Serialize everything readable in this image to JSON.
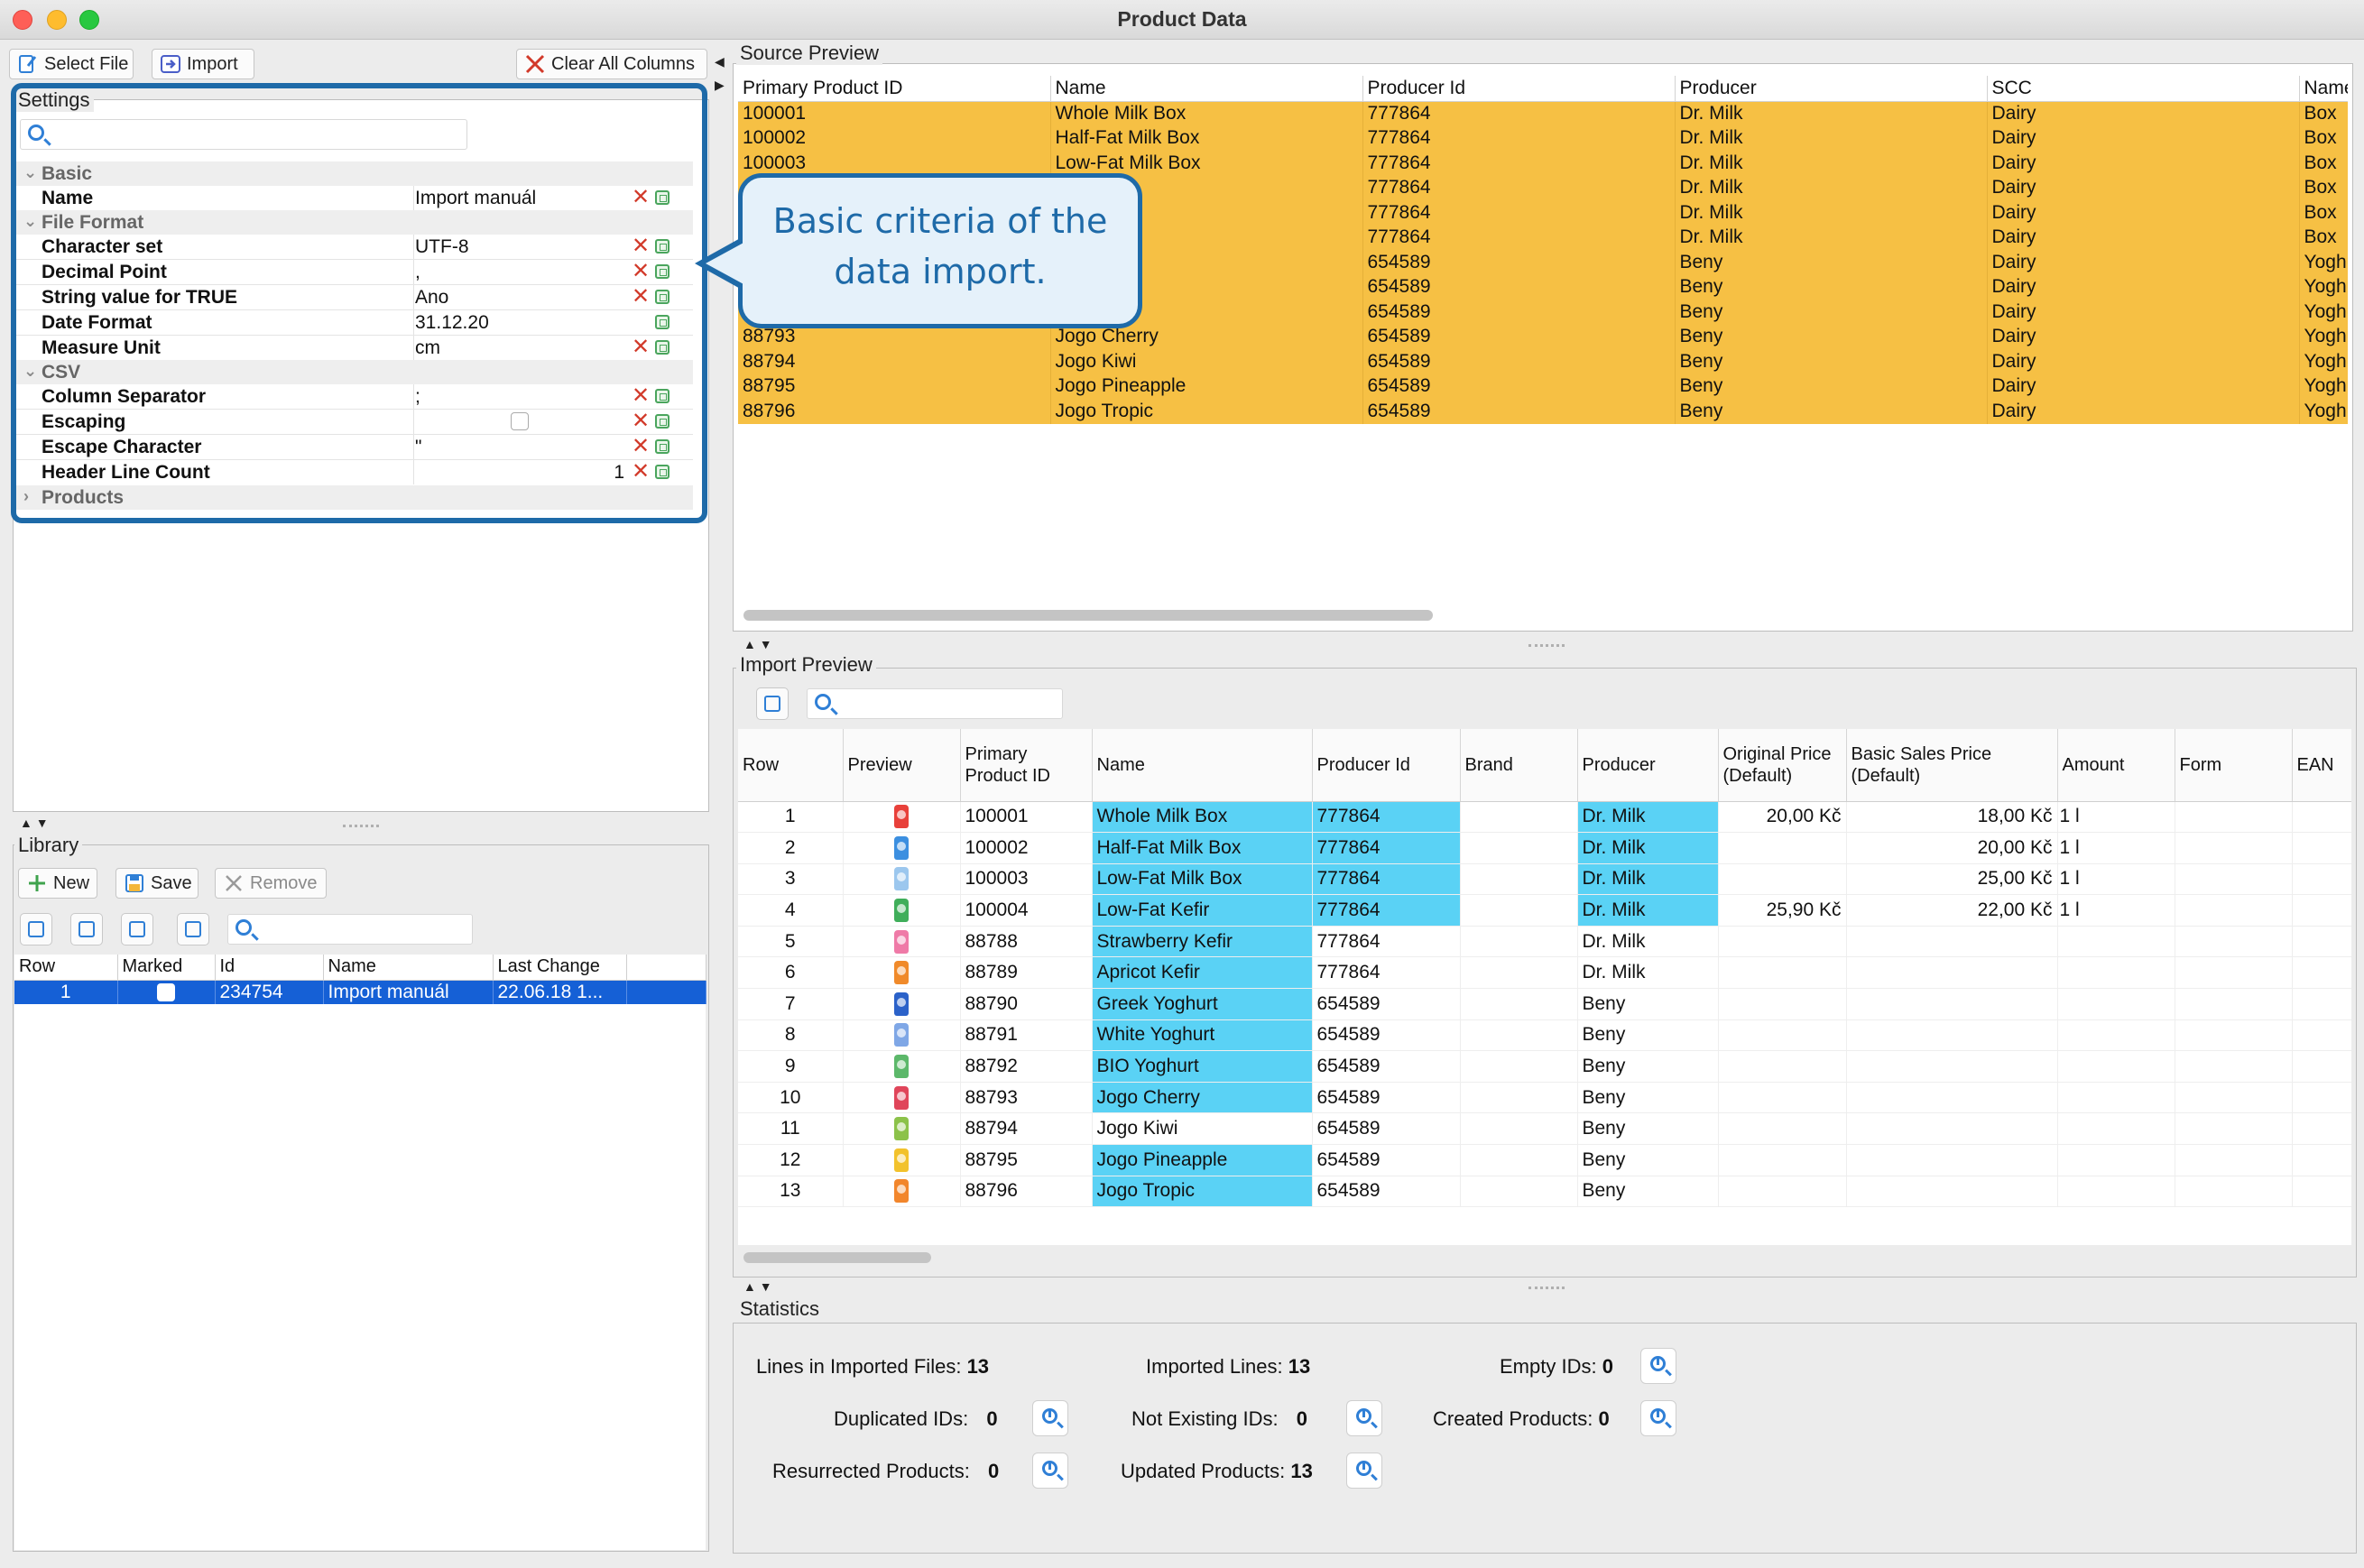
{
  "window": {
    "title": "Product Data",
    "colors": {
      "close": "#fe5f57",
      "minimize": "#febc2e",
      "zoom": "#28c840",
      "highlight_blue": "#5ad2f5",
      "source_orange": "#f6c044",
      "selection": "#1560d6",
      "callout_border": "#1e6aa8"
    }
  },
  "toolbar": {
    "select_file": "Select File",
    "import": "Import",
    "clear_all_columns": "Clear All Columns"
  },
  "settings": {
    "label": "Settings",
    "search_placeholder": "",
    "sections": {
      "basic": "Basic",
      "file_format": "File Format",
      "csv": "CSV",
      "products": "Products"
    },
    "rows": [
      {
        "key": "Name",
        "value": "Import manuál"
      },
      {
        "key": "Character set",
        "value": "UTF-8"
      },
      {
        "key": "Decimal Point",
        "value": ","
      },
      {
        "key": "String value for TRUE",
        "value": "Ano"
      },
      {
        "key": "Date Format",
        "value": "31.12.20"
      },
      {
        "key": "Measure Unit",
        "value": "cm"
      },
      {
        "key": "Column Separator",
        "value": ";"
      },
      {
        "key": "Escaping",
        "value": ""
      },
      {
        "key": "Escape Character",
        "value": "\""
      },
      {
        "key": "Header Line Count",
        "value": "1"
      }
    ]
  },
  "callout": {
    "line1": "Basic criteria of the",
    "line2": "data import."
  },
  "library": {
    "label": "Library",
    "new": "New",
    "save": "Save",
    "remove": "Remove",
    "columns": [
      "Row",
      "Marked",
      "Id",
      "Name",
      "Last Change"
    ],
    "rows": [
      {
        "row": "1",
        "id": "234754",
        "name": "Import manuál",
        "last_change": "22.06.18 1..."
      }
    ]
  },
  "source_preview": {
    "label": "Source Preview",
    "columns": [
      "Primary Product ID",
      "Name",
      "Producer Id",
      "Producer",
      "SCC",
      "Name"
    ],
    "rows": [
      [
        "100001",
        "Whole Milk Box",
        "777864",
        "Dr. Milk",
        "Dairy",
        "Box"
      ],
      [
        "100002",
        "Half-Fat Milk Box",
        "777864",
        "Dr. Milk",
        "Dairy",
        "Box"
      ],
      [
        "100003",
        "Low-Fat Milk Box",
        "777864",
        "Dr. Milk",
        "Dairy",
        "Box"
      ],
      [
        "",
        "Kefir",
        "777864",
        "Dr. Milk",
        "Dairy",
        "Box"
      ],
      [
        "",
        "y Kefir",
        "777864",
        "Dr. Milk",
        "Dairy",
        "Box"
      ],
      [
        "",
        "efir",
        "777864",
        "Dr. Milk",
        "Dairy",
        "Box"
      ],
      [
        "",
        "ghurt",
        "654589",
        "Beny",
        "Dairy",
        "Yoghu"
      ],
      [
        "",
        "hurt",
        "654589",
        "Beny",
        "Dairy",
        "Yoghu"
      ],
      [
        "",
        "urt",
        "654589",
        "Beny",
        "Dairy",
        "Yoghu"
      ],
      [
        "88793",
        "Jogo Cherry",
        "654589",
        "Beny",
        "Dairy",
        "Yoghu"
      ],
      [
        "88794",
        "Jogo Kiwi",
        "654589",
        "Beny",
        "Dairy",
        "Yoghu"
      ],
      [
        "88795",
        "Jogo Pineapple",
        "654589",
        "Beny",
        "Dairy",
        "Yoghu"
      ],
      [
        "88796",
        "Jogo Tropic",
        "654589",
        "Beny",
        "Dairy",
        "Yoghu"
      ]
    ]
  },
  "import_preview": {
    "label": "Import Preview",
    "columns": [
      {
        "l1": "Row",
        "l2": ""
      },
      {
        "l1": "Preview",
        "l2": ""
      },
      {
        "l1": "Primary",
        "l2": "Product ID"
      },
      {
        "l1": "Name",
        "l2": ""
      },
      {
        "l1": "Producer Id",
        "l2": ""
      },
      {
        "l1": "Brand",
        "l2": ""
      },
      {
        "l1": "Producer",
        "l2": ""
      },
      {
        "l1": "Original Price",
        "l2": "(Default)"
      },
      {
        "l1": "Basic Sales Price",
        "l2": "(Default)"
      },
      {
        "l1": "Amount",
        "l2": ""
      },
      {
        "l1": "Form",
        "l2": ""
      },
      {
        "l1": "EAN",
        "l2": ""
      }
    ],
    "rows": [
      {
        "row": "1",
        "color": "#e8403a",
        "id": "100001",
        "name": "Whole Milk Box",
        "producer_id": "777864",
        "producer": "Dr. Milk",
        "orig": "20,00 Kč",
        "sales": "18,00 Kč",
        "amount": "1 l",
        "hl_name": true,
        "hl_pid": true,
        "hl_prod": true
      },
      {
        "row": "2",
        "color": "#3c8fe0",
        "id": "100002",
        "name": "Half-Fat Milk Box",
        "producer_id": "777864",
        "producer": "Dr. Milk",
        "orig": "",
        "sales": "20,00 Kč",
        "amount": "1 l",
        "hl_name": true,
        "hl_pid": true,
        "hl_prod": true
      },
      {
        "row": "3",
        "color": "#9cc7ee",
        "id": "100003",
        "name": "Low-Fat Milk Box",
        "producer_id": "777864",
        "producer": "Dr. Milk",
        "orig": "",
        "sales": "25,00 Kč",
        "amount": "1 l",
        "hl_name": true,
        "hl_pid": true,
        "hl_prod": true
      },
      {
        "row": "4",
        "color": "#3fae5a",
        "id": "100004",
        "name": "Low-Fat Kefir",
        "producer_id": "777864",
        "producer": "Dr. Milk",
        "orig": "25,90 Kč",
        "sales": "22,00 Kč",
        "amount": "1 l",
        "hl_name": true,
        "hl_pid": true,
        "hl_prod": true
      },
      {
        "row": "5",
        "color": "#ef7aa7",
        "id": "88788",
        "name": "Strawberry Kefir",
        "producer_id": "777864",
        "producer": "Dr. Milk",
        "orig": "",
        "sales": "",
        "amount": "",
        "hl_name": true,
        "hl_pid": false,
        "hl_prod": false
      },
      {
        "row": "6",
        "color": "#f08a2a",
        "id": "88789",
        "name": "Apricot Kefir",
        "producer_id": "777864",
        "producer": "Dr. Milk",
        "orig": "",
        "sales": "",
        "amount": "",
        "hl_name": true,
        "hl_pid": false,
        "hl_prod": false
      },
      {
        "row": "7",
        "color": "#2b62c9",
        "id": "88790",
        "name": "Greek Yoghurt",
        "producer_id": "654589",
        "producer": "Beny",
        "orig": "",
        "sales": "",
        "amount": "",
        "hl_name": true,
        "hl_pid": false,
        "hl_prod": false
      },
      {
        "row": "8",
        "color": "#7fa7e6",
        "id": "88791",
        "name": "White Yoghurt",
        "producer_id": "654589",
        "producer": "Beny",
        "orig": "",
        "sales": "",
        "amount": "",
        "hl_name": true,
        "hl_pid": false,
        "hl_prod": false
      },
      {
        "row": "9",
        "color": "#5cb86a",
        "id": "88792",
        "name": "BIO Yoghurt",
        "producer_id": "654589",
        "producer": "Beny",
        "orig": "",
        "sales": "",
        "amount": "",
        "hl_name": true,
        "hl_pid": false,
        "hl_prod": false
      },
      {
        "row": "10",
        "color": "#e0455a",
        "id": "88793",
        "name": "Jogo Cherry",
        "producer_id": "654589",
        "producer": "Beny",
        "orig": "",
        "sales": "",
        "amount": "",
        "hl_name": true,
        "hl_pid": false,
        "hl_prod": false
      },
      {
        "row": "11",
        "color": "#8cc24a",
        "id": "88794",
        "name": "Jogo Kiwi",
        "producer_id": "654589",
        "producer": "Beny",
        "orig": "",
        "sales": "",
        "amount": "",
        "hl_name": false,
        "hl_pid": false,
        "hl_prod": false
      },
      {
        "row": "12",
        "color": "#f2c22c",
        "id": "88795",
        "name": "Jogo Pineapple",
        "producer_id": "654589",
        "producer": "Beny",
        "orig": "",
        "sales": "",
        "amount": "",
        "hl_name": true,
        "hl_pid": false,
        "hl_prod": false
      },
      {
        "row": "13",
        "color": "#f2862c",
        "id": "88796",
        "name": "Jogo Tropic",
        "producer_id": "654589",
        "producer": "Beny",
        "orig": "",
        "sales": "",
        "amount": "",
        "hl_name": true,
        "hl_pid": false,
        "hl_prod": false
      }
    ]
  },
  "statistics": {
    "label": "Statistics",
    "lines_in_files_label": "Lines in Imported Files:",
    "lines_in_files": "13",
    "imported_lines_label": "Imported Lines:",
    "imported_lines": "13",
    "empty_ids_label": "Empty IDs:",
    "empty_ids": "0",
    "duplicated_ids_label": "Duplicated IDs:",
    "duplicated_ids": "0",
    "not_existing_ids_label": "Not Existing IDs:",
    "not_existing_ids": "0",
    "created_products_label": "Created Products:",
    "created_products": "0",
    "resurrected_label": "Resurrected Products:",
    "resurrected": "0",
    "updated_label": "Updated Products:",
    "updated": "13"
  }
}
